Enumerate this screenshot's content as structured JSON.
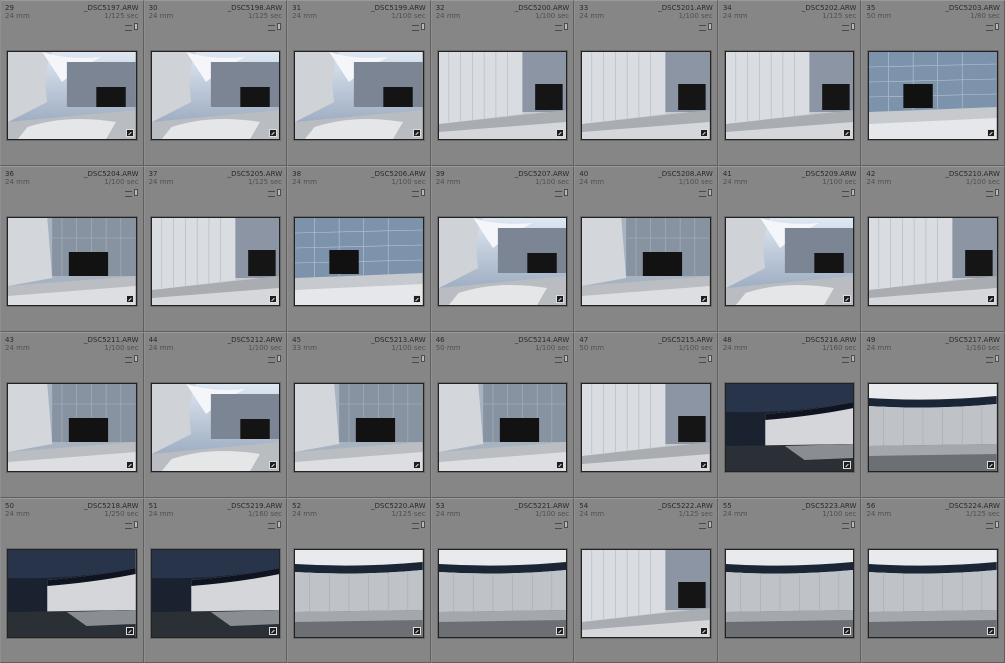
{
  "grid": {
    "cells": [
      {
        "index": "29",
        "filename": "_DSC5197.ARW",
        "focal": "24 mm",
        "shutter": "1/125 sec",
        "scene": "curve"
      },
      {
        "index": "30",
        "filename": "_DSC5198.ARW",
        "focal": "24 mm",
        "shutter": "1/125 sec",
        "scene": "curve"
      },
      {
        "index": "31",
        "filename": "_DSC5199.ARW",
        "focal": "24 mm",
        "shutter": "1/100 sec",
        "scene": "curve"
      },
      {
        "index": "32",
        "filename": "_DSC5200.ARW",
        "focal": "24 mm",
        "shutter": "1/100 sec",
        "scene": "wall"
      },
      {
        "index": "33",
        "filename": "_DSC5201.ARW",
        "focal": "24 mm",
        "shutter": "1/100 sec",
        "scene": "wall"
      },
      {
        "index": "34",
        "filename": "_DSC5202.ARW",
        "focal": "24 mm",
        "shutter": "1/125 sec",
        "scene": "wall"
      },
      {
        "index": "35",
        "filename": "_DSC5203.ARW",
        "focal": "50 mm",
        "shutter": "1/80 sec",
        "scene": "glass"
      },
      {
        "index": "36",
        "filename": "_DSC5204.ARW",
        "focal": "24 mm",
        "shutter": "1/100 sec",
        "scene": "door"
      },
      {
        "index": "37",
        "filename": "_DSC5205.ARW",
        "focal": "24 mm",
        "shutter": "1/125 sec",
        "scene": "wall"
      },
      {
        "index": "38",
        "filename": "_DSC5206.ARW",
        "focal": "24 mm",
        "shutter": "1/100 sec",
        "scene": "glass"
      },
      {
        "index": "39",
        "filename": "_DSC5207.ARW",
        "focal": "24 mm",
        "shutter": "1/100 sec",
        "scene": "curve"
      },
      {
        "index": "40",
        "filename": "_DSC5208.ARW",
        "focal": "24 mm",
        "shutter": "1/100 sec",
        "scene": "door"
      },
      {
        "index": "41",
        "filename": "_DSC5209.ARW",
        "focal": "24 mm",
        "shutter": "1/100 sec",
        "scene": "curve"
      },
      {
        "index": "42",
        "filename": "_DSC5210.ARW",
        "focal": "24 mm",
        "shutter": "1/100 sec",
        "scene": "wall"
      },
      {
        "index": "43",
        "filename": "_DSC5211.ARW",
        "focal": "24 mm",
        "shutter": "1/100 sec",
        "scene": "door"
      },
      {
        "index": "44",
        "filename": "_DSC5212.ARW",
        "focal": "24 mm",
        "shutter": "1/100 sec",
        "scene": "curve"
      },
      {
        "index": "45",
        "filename": "_DSC5213.ARW",
        "focal": "33 mm",
        "shutter": "1/100 sec",
        "scene": "door"
      },
      {
        "index": "46",
        "filename": "_DSC5214.ARW",
        "focal": "50 mm",
        "shutter": "1/100 sec",
        "scene": "door"
      },
      {
        "index": "47",
        "filename": "_DSC5215.ARW",
        "focal": "50 mm",
        "shutter": "1/100 sec",
        "scene": "wall"
      },
      {
        "index": "48",
        "filename": "_DSC5216.ARW",
        "focal": "24 mm",
        "shutter": "1/160 sec",
        "scene": "dark"
      },
      {
        "index": "49",
        "filename": "_DSC5217.ARW",
        "focal": "24 mm",
        "shutter": "1/160 sec",
        "scene": "band"
      },
      {
        "index": "50",
        "filename": "_DSC5218.ARW",
        "focal": "24 mm",
        "shutter": "1/250 sec",
        "scene": "dark"
      },
      {
        "index": "51",
        "filename": "_DSC5219.ARW",
        "focal": "24 mm",
        "shutter": "1/160 sec",
        "scene": "dark"
      },
      {
        "index": "52",
        "filename": "_DSC5220.ARW",
        "focal": "24 mm",
        "shutter": "1/125 sec",
        "scene": "band"
      },
      {
        "index": "53",
        "filename": "_DSC5221.ARW",
        "focal": "24 mm",
        "shutter": "1/100 sec",
        "scene": "band"
      },
      {
        "index": "54",
        "filename": "_DSC5222.ARW",
        "focal": "24 mm",
        "shutter": "1/125 sec",
        "scene": "wall"
      },
      {
        "index": "55",
        "filename": "_DSC5223.ARW",
        "focal": "24 mm",
        "shutter": "1/100 sec",
        "scene": "band"
      },
      {
        "index": "56",
        "filename": "_DSC5224.ARW",
        "focal": "24 mm",
        "shutter": "1/125 sec",
        "scene": "band"
      }
    ]
  },
  "icons": {
    "metadata": "metadata-icon",
    "crop": "crop-badge-icon"
  }
}
